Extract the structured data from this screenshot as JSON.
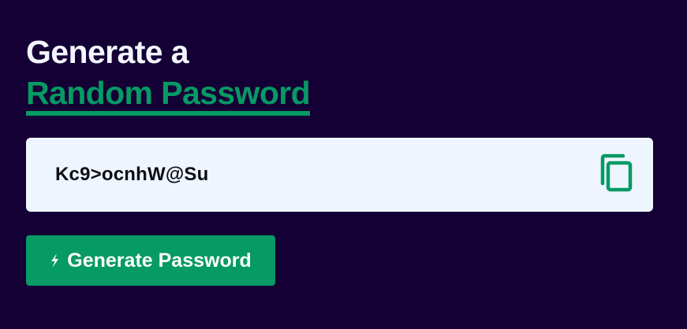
{
  "heading": {
    "line1": "Generate a",
    "line2": "Random Password"
  },
  "password": {
    "value": "Kc9>ocnhW@Su"
  },
  "generate_button": {
    "label": "Generate Password"
  },
  "icons": {
    "copy": "copy-icon",
    "generate": "lightning-bolt-icon"
  },
  "colors": {
    "background": "#150035",
    "accent": "#069a64",
    "heading_text": "#f2f5ff",
    "field_background": "#eef5ff"
  }
}
